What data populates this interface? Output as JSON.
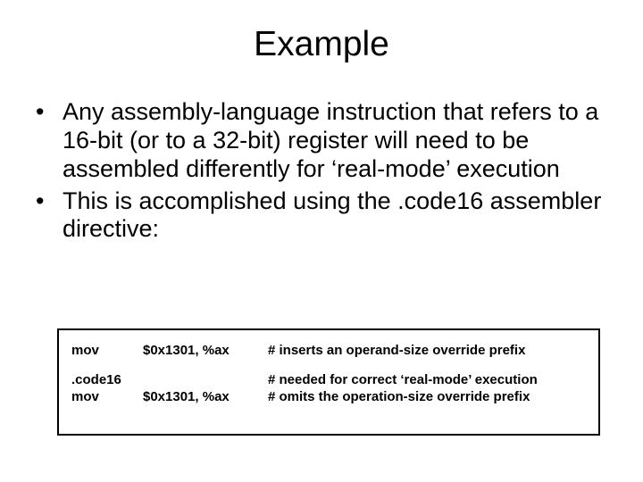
{
  "title": "Example",
  "bullets": [
    "Any assembly-language instruction that refers to a 16-bit (or to a 32-bit) register will need to be assembled differently for ‘real-mode’ execution",
    "This is accomplished using the .code16 assembler directive:"
  ],
  "code": {
    "row1": {
      "op": "mov",
      "args": "$0x1301, %ax",
      "comment": "# inserts an operand-size override prefix"
    },
    "row2a": {
      "op": ".code16",
      "args": "",
      "comment": "# needed for correct ‘real-mode’ execution"
    },
    "row2b": {
      "op": "mov",
      "args": "$0x1301, %ax",
      "comment": "# omits the operation-size override prefix"
    }
  }
}
